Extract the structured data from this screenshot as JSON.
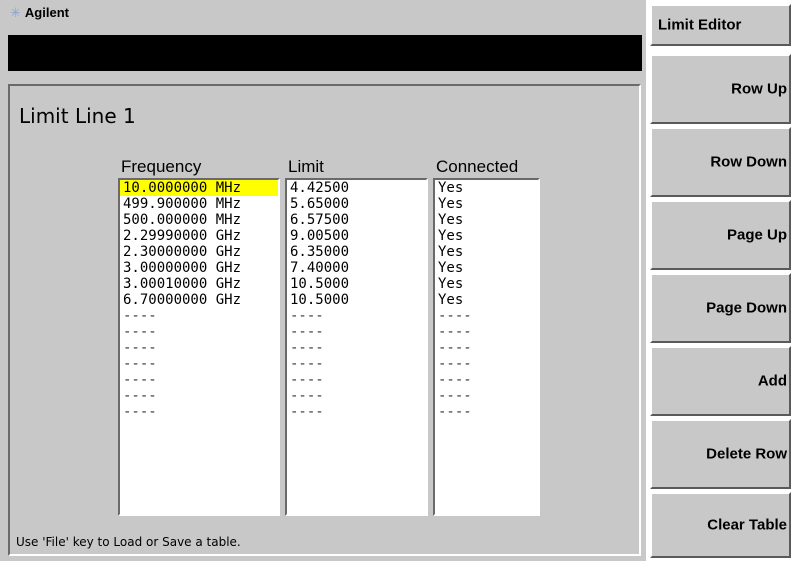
{
  "header": {
    "brand": "Agilent",
    "brand_icon": "spark-logo-icon"
  },
  "content": {
    "title": "Limit Line 1",
    "columns": {
      "frequency": "Frequency",
      "limit": "Limit",
      "connected": "Connected"
    },
    "rows": [
      {
        "frequency": "10.0000000 MHz",
        "limit": "4.42500",
        "connected": "Yes"
      },
      {
        "frequency": "499.900000 MHz",
        "limit": "5.65000",
        "connected": "Yes"
      },
      {
        "frequency": "500.000000 MHz",
        "limit": "6.57500",
        "connected": "Yes"
      },
      {
        "frequency": "2.29990000 GHz",
        "limit": "9.00500",
        "connected": "Yes"
      },
      {
        "frequency": "2.30000000 GHz",
        "limit": "6.35000",
        "connected": "Yes"
      },
      {
        "frequency": "3.00000000 GHz",
        "limit": "7.40000",
        "connected": "Yes"
      },
      {
        "frequency": "3.00010000 GHz",
        "limit": "10.5000",
        "connected": "Yes"
      },
      {
        "frequency": "6.70000000 GHz",
        "limit": "10.5000",
        "connected": "Yes"
      },
      {
        "frequency": "----",
        "limit": "----",
        "connected": "----"
      },
      {
        "frequency": "----",
        "limit": "----",
        "connected": "----"
      },
      {
        "frequency": "----",
        "limit": "----",
        "connected": "----"
      },
      {
        "frequency": "----",
        "limit": "----",
        "connected": "----"
      },
      {
        "frequency": "----",
        "limit": "----",
        "connected": "----"
      },
      {
        "frequency": "----",
        "limit": "----",
        "connected": "----"
      },
      {
        "frequency": "----",
        "limit": "----",
        "connected": "----"
      }
    ],
    "selected_row": 0,
    "hint": "Use 'File' key to Load or Save a table."
  },
  "softkeys": {
    "title": "Limit Editor",
    "items": [
      {
        "label": "Row Up"
      },
      {
        "label": "Row Down"
      },
      {
        "label": "Page Up"
      },
      {
        "label": "Page Down"
      },
      {
        "label": "Add"
      },
      {
        "label": "Delete Row"
      },
      {
        "label": "Clear Table"
      }
    ]
  },
  "colors": {
    "selection": "#ffff00",
    "panel": "#c8c8c8",
    "status_bar": "#000000"
  }
}
